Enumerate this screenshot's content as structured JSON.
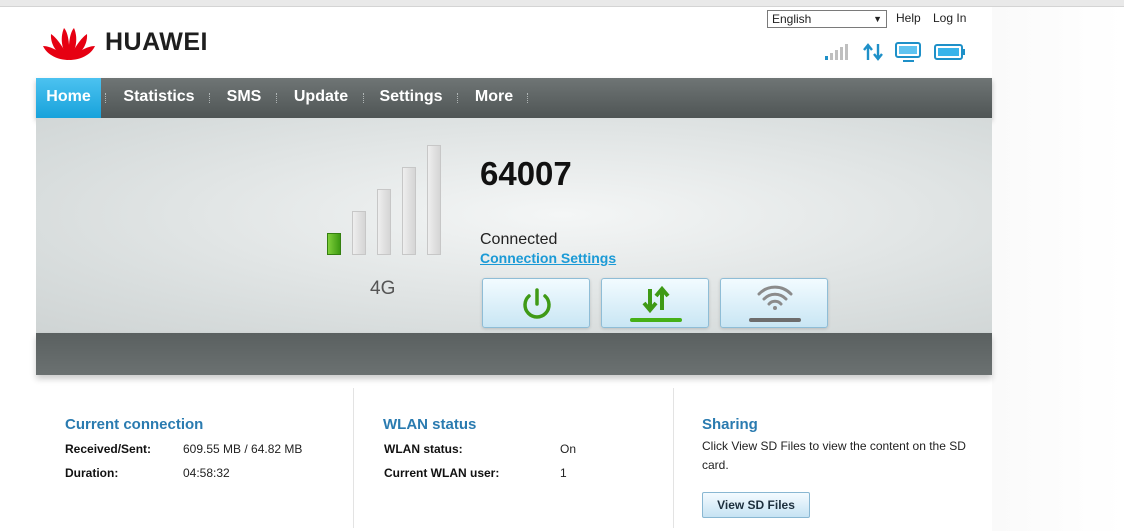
{
  "brand": {
    "name": "HUAWEI",
    "logo_color": "#e60012",
    "logo_icon": "huawei-petal-logo"
  },
  "header": {
    "language": {
      "selected": "English"
    },
    "help_label": "Help",
    "login_label": "Log In",
    "status_icons": [
      "signal-strength-icon",
      "data-transfer-icon",
      "monitor-icon",
      "battery-icon"
    ]
  },
  "nav": {
    "items": [
      {
        "label": "Home",
        "active": true
      },
      {
        "label": "Statistics",
        "active": false
      },
      {
        "label": "SMS",
        "active": false
      },
      {
        "label": "Update",
        "active": false
      },
      {
        "label": "Settings",
        "active": false
      },
      {
        "label": "More",
        "active": false
      }
    ]
  },
  "hero": {
    "signal_bars_total": 5,
    "signal_bars_on": 1,
    "network_type": "4G",
    "operator": "64007",
    "connection_state": "Connected",
    "connection_settings_label": "Connection Settings",
    "buttons": [
      {
        "icon": "power-icon"
      },
      {
        "icon": "data-toggle-icon"
      },
      {
        "icon": "wifi-icon"
      }
    ]
  },
  "current_connection": {
    "title": "Current connection",
    "received_sent_label": "Received/Sent:",
    "received_sent_value": "609.55 MB /  64.82 MB",
    "duration_label": "Duration:",
    "duration_value": "04:58:32"
  },
  "wlan": {
    "title": "WLAN status",
    "status_label": "WLAN status:",
    "status_value": "On",
    "users_label": "Current WLAN user:",
    "users_value": "1"
  },
  "sharing": {
    "title": "Sharing",
    "description": "Click View SD Files to view the content on the SD card.",
    "button_label": "View SD Files"
  },
  "colors": {
    "accent_blue": "#1b9ad6",
    "nav_active": "#2bb0e6",
    "title_blue": "#2a7bb0",
    "green": "#3d9a12"
  }
}
